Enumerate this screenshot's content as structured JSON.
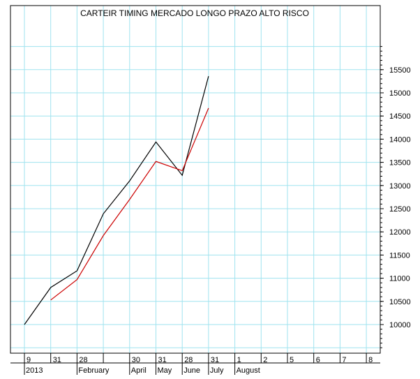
{
  "chart_data": {
    "type": "line",
    "title": "CARTEIR TIMING MERCADO LONGO PRAZO ALTO RISCO",
    "xlabel": "",
    "ylabel": "",
    "ylim": [
      9500,
      16000
    ],
    "grid": true,
    "y_ticks": [
      10000,
      10500,
      11000,
      11500,
      12000,
      12500,
      13000,
      13500,
      14000,
      14500,
      15000,
      15500
    ],
    "x_tick_labels": [
      "9",
      "31",
      "28",
      "",
      "30",
      "31",
      "28",
      "31",
      "1",
      "2",
      "5",
      "6",
      "7",
      "8"
    ],
    "x_period_labels": [
      {
        "tick": 0,
        "label": "2013"
      },
      {
        "tick": 2,
        "label": "February"
      },
      {
        "tick": 4,
        "label": "April"
      },
      {
        "tick": 5,
        "label": "May"
      },
      {
        "tick": 6,
        "label": "June"
      },
      {
        "tick": 7,
        "label": "July"
      },
      {
        "tick": 8,
        "label": "August"
      }
    ],
    "series": [
      {
        "color": "#000000",
        "points": [
          {
            "x": 0,
            "y": 10000
          },
          {
            "x": 1,
            "y": 10800
          },
          {
            "x": 2,
            "y": 11160
          },
          {
            "x": 3,
            "y": 12390
          },
          {
            "x": 4,
            "y": 13100
          },
          {
            "x": 5,
            "y": 13940
          },
          {
            "x": 6,
            "y": 13220
          },
          {
            "x": 7,
            "y": 15360
          }
        ]
      },
      {
        "color": "#cc0000",
        "points": [
          {
            "x": 1,
            "y": 10530
          },
          {
            "x": 2,
            "y": 10970
          },
          {
            "x": 3,
            "y": 11920
          },
          {
            "x": 4,
            "y": 12700
          },
          {
            "x": 5,
            "y": 13520
          },
          {
            "x": 6,
            "y": 13320
          },
          {
            "x": 7,
            "y": 14670
          }
        ]
      }
    ]
  }
}
